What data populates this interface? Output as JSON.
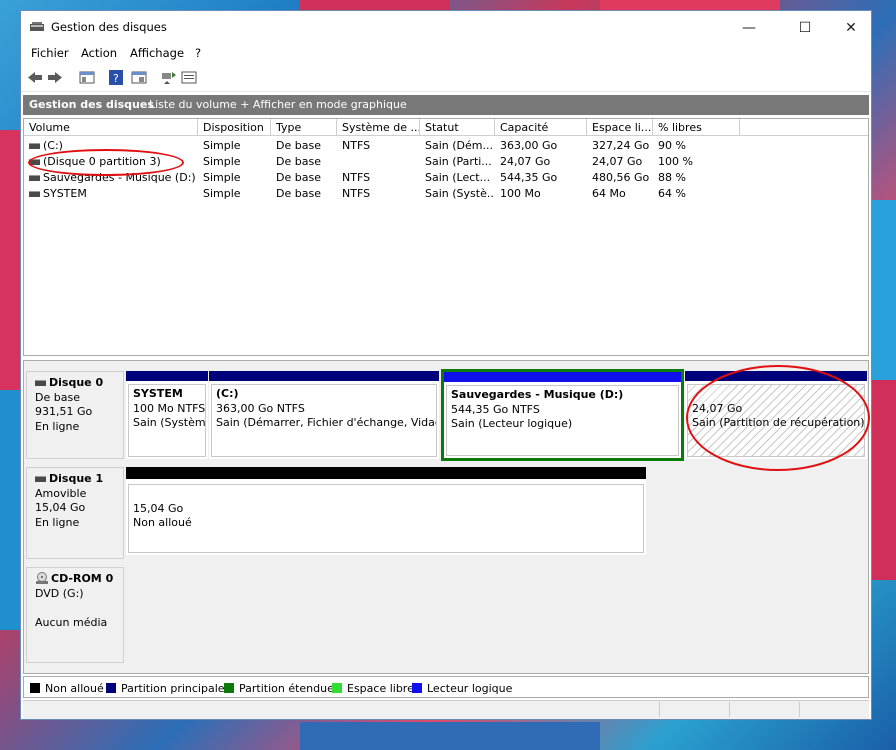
{
  "window": {
    "title": "Gestion des disques",
    "controls": {
      "minimize": "—",
      "maximize": "☐",
      "close": "✕"
    }
  },
  "menu": [
    "Fichier",
    "Action",
    "Affichage",
    "?"
  ],
  "toolbar_icons": [
    "back-icon",
    "forward-icon",
    "show-hide-console-tree-icon",
    "help-icon",
    "properties-icon",
    "rescan-icon",
    "list-view-icon"
  ],
  "header": {
    "title": "Gestion des disques",
    "subtitle": "Liste du volume + Afficher en mode graphique"
  },
  "columns": [
    "Volume",
    "Disposition",
    "Type",
    "Système de ...",
    "Statut",
    "Capacité",
    "Espace li...",
    "% libres"
  ],
  "volumes": [
    {
      "volume": "(C:)",
      "disposition": "Simple",
      "type": "De base",
      "fs": "NTFS",
      "status": "Sain (Dém...",
      "capacity": "363,00 Go",
      "free": "327,24 Go",
      "pct": "90 %"
    },
    {
      "volume": "(Disque 0 partition 3)",
      "disposition": "Simple",
      "type": "De base",
      "fs": "",
      "status": "Sain (Parti...",
      "capacity": "24,07 Go",
      "free": "24,07 Go",
      "pct": "100 %"
    },
    {
      "volume": "Sauvegardes - Musique (D:)",
      "disposition": "Simple",
      "type": "De base",
      "fs": "NTFS",
      "status": "Sain (Lect...",
      "capacity": "544,35 Go",
      "free": "480,56 Go",
      "pct": "88 %"
    },
    {
      "volume": "SYSTEM",
      "disposition": "Simple",
      "type": "De base",
      "fs": "NTFS",
      "status": "Sain (Systè...",
      "capacity": "100 Mo",
      "free": "64 Mo",
      "pct": "64 %"
    }
  ],
  "disks": [
    {
      "name": "Disque 0",
      "line1": "De base",
      "line2": "931,51 Go",
      "line3": "En ligne",
      "partitions": [
        {
          "name": "SYSTEM",
          "size": "100 Mo NTFS",
          "status": "Sain (Système"
        },
        {
          "name": "(C:)",
          "size": "363,00 Go NTFS",
          "status": "Sain (Démarrer, Fichier d'échange, Vidage s"
        },
        {
          "name": "Sauvegardes - Musique  (D:)",
          "size": "544,35 Go NTFS",
          "status": "Sain (Lecteur logique)"
        },
        {
          "name": "",
          "size": "24,07 Go",
          "status": "Sain (Partition de récupération)"
        }
      ]
    },
    {
      "name": "Disque 1",
      "line1": "Amovible",
      "line2": "15,04 Go",
      "line3": "En ligne",
      "partitions": [
        {
          "name": "",
          "size": "15,04 Go",
          "status": "Non alloué"
        }
      ]
    },
    {
      "name": "CD-ROM 0",
      "line1": "DVD (G:)",
      "line2": "",
      "line3": "Aucun média",
      "partitions": []
    }
  ],
  "legend": [
    {
      "label": "Non alloué",
      "color": "#000000"
    },
    {
      "label": "Partition principale",
      "color": "#00007a"
    },
    {
      "label": "Partition étendue",
      "color": "#0a7a0a"
    },
    {
      "label": "Espace libre",
      "color": "#33dd33"
    },
    {
      "label": "Lecteur logique",
      "color": "#1010ee"
    }
  ],
  "colors": {
    "primary_bar": "#00007a",
    "logical_bar": "#1010ee",
    "extended_border": "#0a7a0a",
    "unallocated_bar": "#000000",
    "annotation": "#e01010"
  }
}
